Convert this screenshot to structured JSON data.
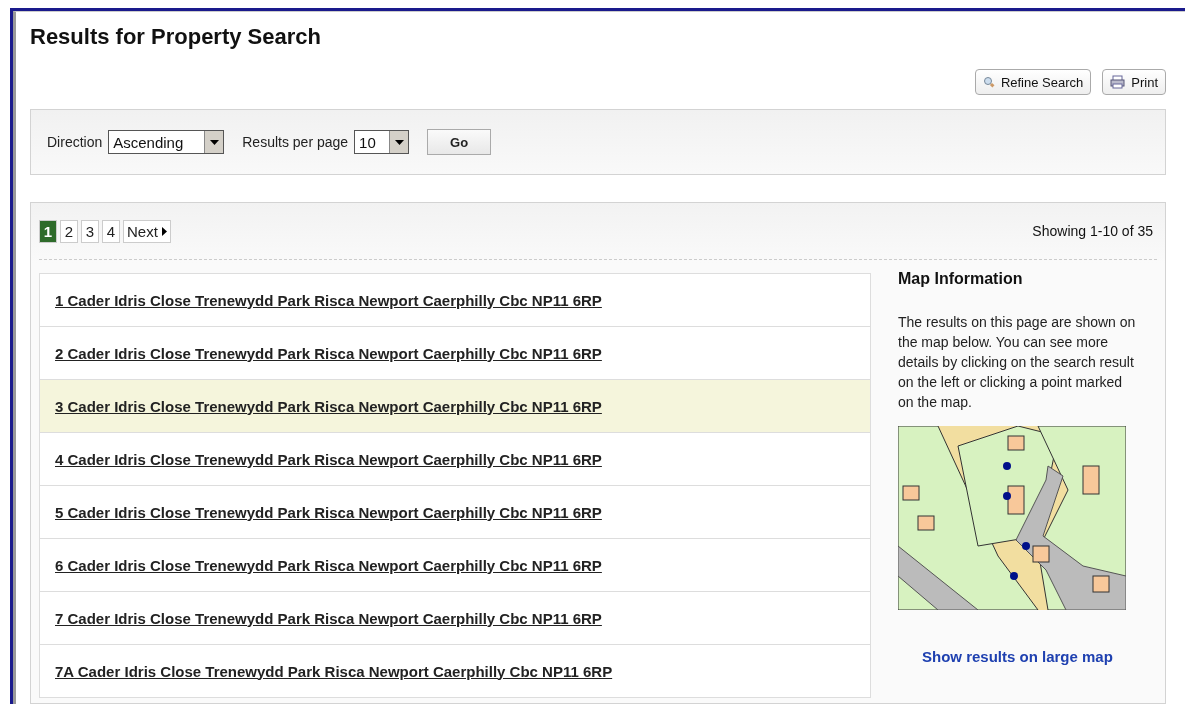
{
  "title": "Results for Property Search",
  "actions": [
    {
      "kind": "search",
      "label": "Refine Search"
    },
    {
      "kind": "print",
      "label": "Print"
    }
  ],
  "sort_bar": {
    "direction_label": "Direction",
    "direction_value": "Ascending",
    "per_page_label": "Results per page",
    "per_page_value": "10",
    "go_label": "Go"
  },
  "pagination": {
    "pages": [
      {
        "label": "1",
        "selected": true
      },
      {
        "label": "2",
        "selected": false
      },
      {
        "label": "3",
        "selected": false
      },
      {
        "label": "4",
        "selected": false
      }
    ],
    "next_label": "Next",
    "showing": "Showing 1-10 of 35"
  },
  "results": [
    {
      "address": "1 Cader Idris Close Trenewydd Park Risca Newport Caerphilly Cbc NP11 6RP",
      "highlighted": false
    },
    {
      "address": "2 Cader Idris Close Trenewydd Park Risca Newport Caerphilly Cbc NP11 6RP",
      "highlighted": false
    },
    {
      "address": "3 Cader Idris Close Trenewydd Park Risca Newport Caerphilly Cbc NP11 6RP",
      "highlighted": true
    },
    {
      "address": "4 Cader Idris Close Trenewydd Park Risca Newport Caerphilly Cbc NP11 6RP",
      "highlighted": false
    },
    {
      "address": "5 Cader Idris Close Trenewydd Park Risca Newport Caerphilly Cbc NP11 6RP",
      "highlighted": false
    },
    {
      "address": "6 Cader Idris Close Trenewydd Park Risca Newport Caerphilly Cbc NP11 6RP",
      "highlighted": false
    },
    {
      "address": "7 Cader Idris Close Trenewydd Park Risca Newport Caerphilly Cbc NP11 6RP",
      "highlighted": false
    },
    {
      "address": "7A Cader Idris Close Trenewydd Park Risca Newport Caerphilly Cbc NP11 6RP",
      "highlighted": false
    }
  ],
  "map_info": {
    "heading": "Map Information",
    "text": "The results on this page are shown on the map below. You can see more details by clicking on the search result on the left or clicking a point marked on the map.",
    "link": "Show results on large map"
  }
}
